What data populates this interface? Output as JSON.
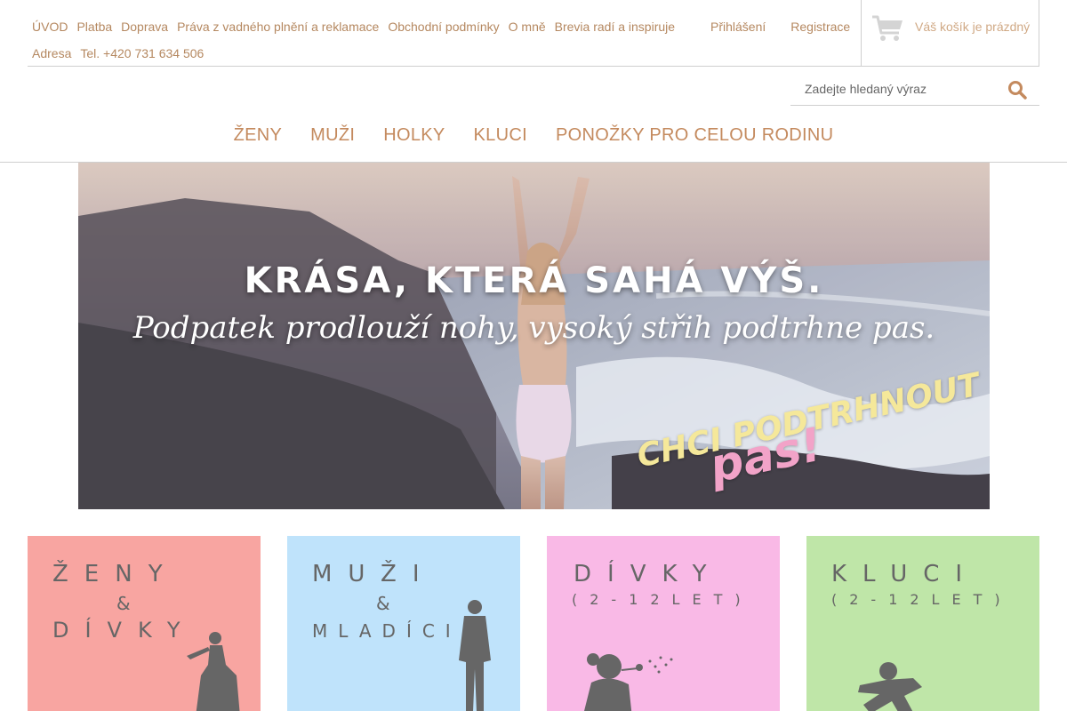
{
  "topbar": {
    "links_row1": [
      "ÚVOD",
      "Platba",
      "Doprava",
      "Práva z vadného plnění a reklamace",
      "Obchodní podmínky",
      "O mně",
      "Brevia radí a inspiruje"
    ],
    "links_row2": [
      "Adresa",
      "Tel. +420 731 634 506"
    ],
    "login": "Přihlášení",
    "register": "Registrace",
    "cart_text": "Váš košík je prázdný"
  },
  "search": {
    "placeholder": "Zadejte hledaný výraz"
  },
  "mainnav": {
    "items": [
      "ŽENY",
      "MUŽI",
      "HOLKY",
      "KLUCI",
      "PONOŽKY PRO CELOU RODINU"
    ]
  },
  "hero": {
    "title": "KRÁSA, KTERÁ SAHÁ VÝŠ.",
    "subtitle": "Podpatek prodlouží nohy, vysoký střih podtrhne pas.",
    "cta_line1": "CHCI PODTRHNOUT",
    "cta_line2": "pas!"
  },
  "tiles": [
    {
      "l1": "ŽENY",
      "l2": "&",
      "l3": "DÍVKY",
      "bg": "#f8a5a1"
    },
    {
      "l1": "MUŽI",
      "l2": "&",
      "l3": "MLADÍCI",
      "bg": "#bfe3fb"
    },
    {
      "l1": "DÍVKY",
      "l2": "(2-12LET)",
      "l3": "",
      "bg": "#f9b9e6"
    },
    {
      "l1": "KLUCI",
      "l2": "(2-12LET)",
      "l3": "",
      "bg": "#bfe6a8"
    }
  ],
  "colors": {
    "link": "#b58860",
    "nav": "#c48a5e",
    "border": "#cfcfcf"
  }
}
